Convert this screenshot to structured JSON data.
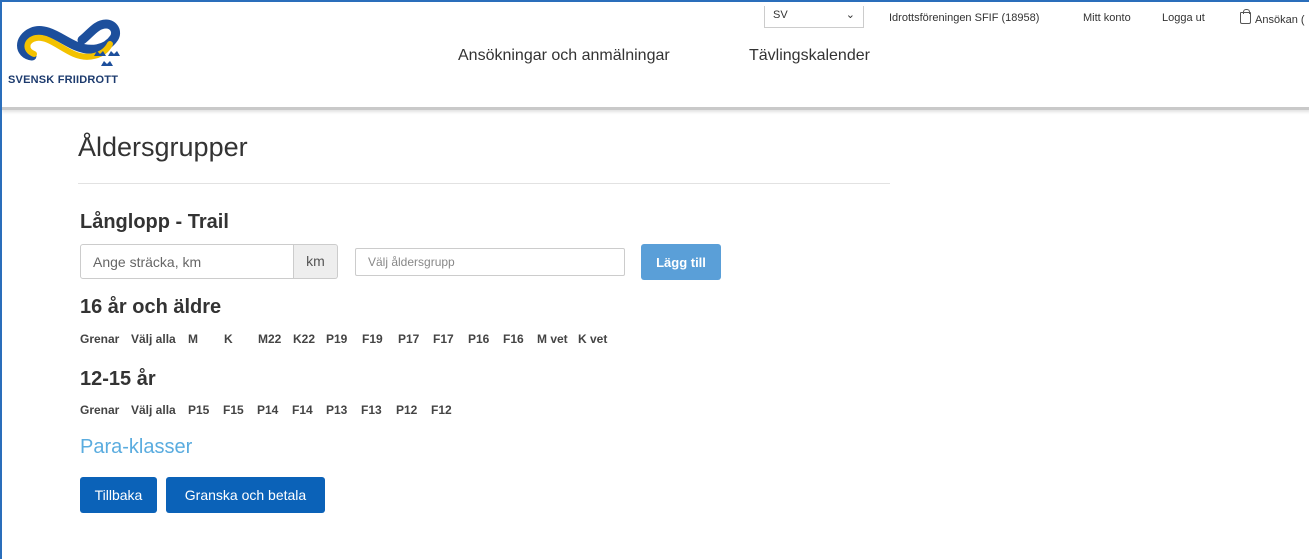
{
  "header": {
    "logo_text": "SVENSK FRIIDROTT",
    "nav": [
      "Ansökningar och anmälningar",
      "Tävlingskalender"
    ],
    "language": "SV",
    "organization": "Idrottsföreningen SFIF (18958)",
    "my_account": "Mitt konto",
    "logout": "Logga ut",
    "application": "Ansökan ("
  },
  "page": {
    "title": "Åldersgrupper",
    "section_title": "Långlopp - Trail",
    "distance_placeholder": "Ange sträcka, km",
    "distance_unit": "km",
    "age_placeholder": "Välj åldersgrupp",
    "add_button": "Lägg till"
  },
  "groups": [
    {
      "title": "16 år och äldre",
      "label": "Grenar",
      "select_all": "Välj alla",
      "classes": [
        "M",
        "K",
        "M22",
        "K22",
        "P19",
        "F19",
        "P17",
        "F17",
        "P16",
        "F16",
        "M vet",
        "K vet"
      ]
    },
    {
      "title": "12-15 år",
      "label": "Grenar",
      "select_all": "Välj alla",
      "classes": [
        "P15",
        "F15",
        "P14",
        "F14",
        "P13",
        "F13",
        "P12",
        "F12"
      ]
    }
  ],
  "para_link": "Para-klasser",
  "buttons": {
    "back": "Tillbaka",
    "review": "Granska och betala"
  },
  "colors": {
    "primary_button": "#0b62b8",
    "add_button": "#5a9fd8",
    "para_link": "#5aacdf"
  }
}
